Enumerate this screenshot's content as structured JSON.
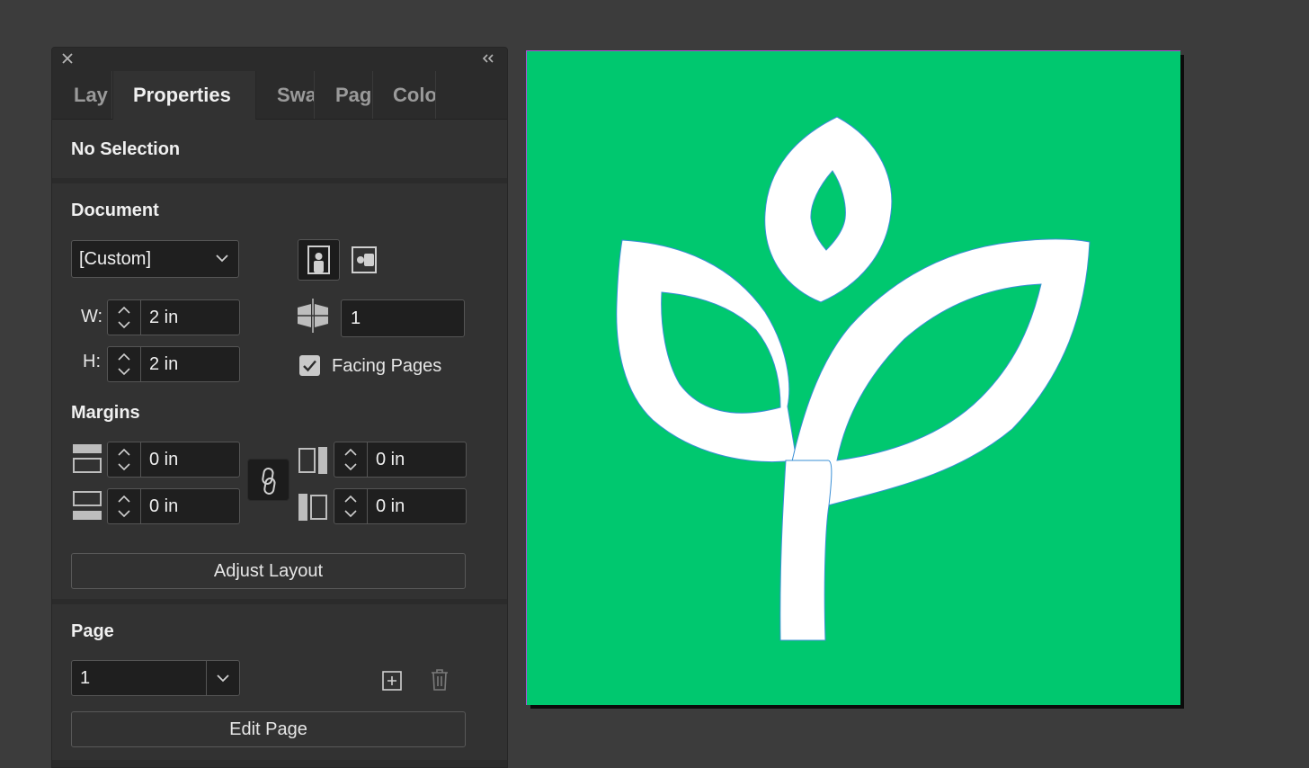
{
  "panel": {
    "tabs": [
      {
        "label": "Lay"
      },
      {
        "label": "Properties"
      },
      {
        "label": "Swa"
      },
      {
        "label": "Pag"
      },
      {
        "label": "Colo"
      }
    ],
    "selection_status": "No Selection"
  },
  "document": {
    "title": "Document",
    "preset": "[Custom]",
    "width_label": "W:",
    "width": "2 in",
    "height_label": "H:",
    "height": "2 in",
    "pages": "1",
    "facing_pages_label": "Facing Pages",
    "facing_pages_checked": true,
    "orientation": "portrait"
  },
  "margins": {
    "title": "Margins",
    "top": "0 in",
    "bottom": "0 in",
    "inside": "0 in",
    "outside": "0 in",
    "adjust_layout_label": "Adjust Layout"
  },
  "page": {
    "title": "Page",
    "current": "1",
    "edit_page_label": "Edit Page"
  },
  "artwork": {
    "background_color": "#00c86f",
    "foreground_color": "#ffffff",
    "subject": "plant-sprout-icon"
  }
}
